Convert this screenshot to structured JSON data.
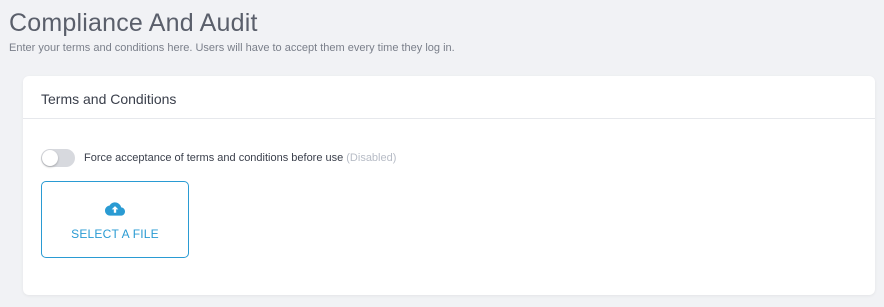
{
  "page": {
    "title": "Compliance And Audit",
    "subtitle": "Enter your terms and conditions here. Users will have to accept them every time they log in."
  },
  "terms_card": {
    "title": "Terms and Conditions",
    "toggle": {
      "label": "Force acceptance of terms and conditions before use",
      "status": "(Disabled)",
      "enabled": false
    },
    "file_select": {
      "icon": "cloud-upload-icon",
      "label": "SELECT A FILE"
    }
  },
  "colors": {
    "accent": "#2a9bd3",
    "background": "#f1f2f5",
    "card": "#ffffff",
    "toggle_off": "#d7d9de",
    "muted_text": "#b7bcc6"
  }
}
